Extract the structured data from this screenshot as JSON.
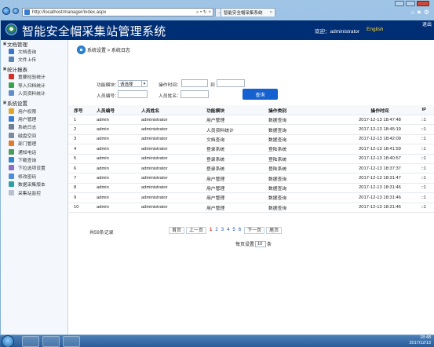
{
  "browser": {
    "address": "http://localhost/manager/index.aspx",
    "tab_inactive": "…",
    "tab_active": "智能安全帽采集系统",
    "tab_close": "×",
    "addr_controls": "⌕ • ↻ ×",
    "tools": "⌂ ★ ⚙"
  },
  "header": {
    "title": "智能安全帽采集站管理系统",
    "welcome": "欢迎：administrator",
    "language": "English",
    "logout": "退出"
  },
  "sidebar": {
    "groups": [
      {
        "title": "文档管理",
        "items": [
          {
            "label": "文档查询",
            "icon": "document-icon",
            "color": "#3a77c9"
          },
          {
            "label": "文件上传",
            "icon": "upload-icon",
            "color": "#5a86b5"
          }
        ]
      },
      {
        "title": "统计报表",
        "items": [
          {
            "label": "重要检验统计",
            "icon": "star-icon",
            "color": "#d2302a"
          },
          {
            "label": "导入归档统计",
            "icon": "import-icon",
            "color": "#38a34c"
          },
          {
            "label": "人员资料统计",
            "icon": "user-icon",
            "color": "#5e8fc7"
          }
        ]
      },
      {
        "title": "系统设置",
        "items": [
          {
            "label": "用户权限",
            "icon": "key-icon",
            "color": "#e0a52a"
          },
          {
            "label": "用户管理",
            "icon": "users-icon",
            "color": "#3b7dd0"
          },
          {
            "label": "系统日志",
            "icon": "log-icon",
            "color": "#6f7f95"
          },
          {
            "label": "磁盘空间",
            "icon": "disk-icon",
            "color": "#7c8a9c"
          },
          {
            "label": "部门管理",
            "icon": "department-icon",
            "color": "#e07b2a"
          },
          {
            "label": "通知电话",
            "icon": "phone-icon",
            "color": "#4a9a5c"
          },
          {
            "label": "下载查询",
            "icon": "download-icon",
            "color": "#2f86c8"
          },
          {
            "label": "下拉选项设置",
            "icon": "list-icon",
            "color": "#8a6fc2"
          },
          {
            "label": "修改密码",
            "icon": "password-icon",
            "color": "#4d8fd6"
          },
          {
            "label": "数据采集版本",
            "icon": "version-icon",
            "color": "#2e9fa4"
          },
          {
            "label": "采集站监控",
            "icon": "monitor-icon",
            "color": "#b8c2cf"
          }
        ]
      }
    ]
  },
  "breadcrumb": "系统设置 > 系统日志",
  "filters": {
    "module_label": "功能模块：",
    "module_value": "请选择",
    "time_label": "操作时间：",
    "time_from": "",
    "time_to_label": "到",
    "time_to": "",
    "user_no_label": "人员编号：",
    "user_no": "",
    "user_name_label": "人员姓名：",
    "user_name": "",
    "search_button": "查询"
  },
  "table": {
    "headers": [
      "序号",
      "人员编号",
      "人员姓名",
      "功能模块",
      "操作类别",
      "操作时间",
      "IP"
    ],
    "rows": [
      [
        "1",
        "admin",
        "administrator",
        "用户管理",
        "数据查询",
        "2017-12-13 18:47:48",
        "::1"
      ],
      [
        "2",
        "admin",
        "administrator",
        "人员资料统计",
        "数据查询",
        "2017-12-13 18:45:19",
        "::1"
      ],
      [
        "3",
        "admin",
        "administrator",
        "文档查询",
        "数据查询",
        "2017-12-13 18:42:09",
        "::1"
      ],
      [
        "4",
        "admin",
        "administrator",
        "登录系统",
        "登陆系统",
        "2017-12-13 18:41:59",
        "::1"
      ],
      [
        "5",
        "admin",
        "administrator",
        "登录系统",
        "登陆系统",
        "2017-12-13 18:40:57",
        "::1"
      ],
      [
        "6",
        "admin",
        "administrator",
        "登录系统",
        "登陆系统",
        "2017-12-13 18:37:37",
        "::1"
      ],
      [
        "7",
        "admin",
        "administrator",
        "用户管理",
        "数据查询",
        "2017-12-13 18:31:47",
        "::1"
      ],
      [
        "8",
        "admin",
        "administrator",
        "用户管理",
        "数据查询",
        "2017-12-13 18:31:46",
        "::1"
      ],
      [
        "9",
        "admin",
        "administrator",
        "用户管理",
        "数据查询",
        "2017-12-13 18:31:46",
        "::1"
      ],
      [
        "10",
        "admin",
        "administrator",
        "用户管理",
        "数据查询",
        "2017-12-13 18:31:46",
        "::1"
      ]
    ]
  },
  "pagination": {
    "total": "共59条记录",
    "first": "首页",
    "prev": "上一页",
    "pages": [
      "1",
      "2",
      "3",
      "4",
      "5",
      "6"
    ],
    "current": "1",
    "next": "下一页",
    "last": "尾页",
    "page_size_label": "每页设置",
    "page_size": "10",
    "page_size_unit": "条"
  },
  "taskbar": {
    "time": "18:48",
    "date": "2017/12/13"
  }
}
